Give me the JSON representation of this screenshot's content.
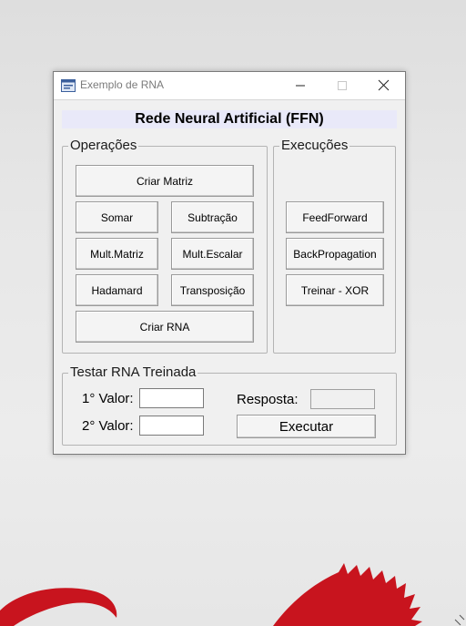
{
  "window": {
    "title": "Exemplo de RNA",
    "titlebar_icons": [
      "app-form-icon",
      "minimize-icon",
      "maximize-icon",
      "close-icon"
    ]
  },
  "heading": "Rede Neural Artificial (FFN)",
  "operacoes": {
    "legend": "Operações",
    "buttons": {
      "criar_matriz": "Criar Matriz",
      "somar": "Somar",
      "subtracao": "Subtração",
      "mult_matriz": "Mult.Matriz",
      "mult_escalar": "Mult.Escalar",
      "hadamard": "Hadamard",
      "transposicao": "Transposição",
      "criar_rna": "Criar RNA"
    }
  },
  "execucoes": {
    "legend": "Execuções",
    "buttons": {
      "feedforward": "FeedForward",
      "backpropagation": "BackPropagation",
      "treinar_xor": "Treinar - XOR"
    }
  },
  "testar": {
    "legend": "Testar RNA Treinada",
    "valor1_label": "1° Valor:",
    "valor1_value": "",
    "valor2_label": "2° Valor:",
    "valor2_value": "",
    "resposta_label": "Resposta:",
    "resposta_value": "",
    "executar": "Executar"
  },
  "colors": {
    "window_bg": "#f0f0f0",
    "heading_bg": "#e9e9f9",
    "desktop_accent": "#c8141e"
  }
}
